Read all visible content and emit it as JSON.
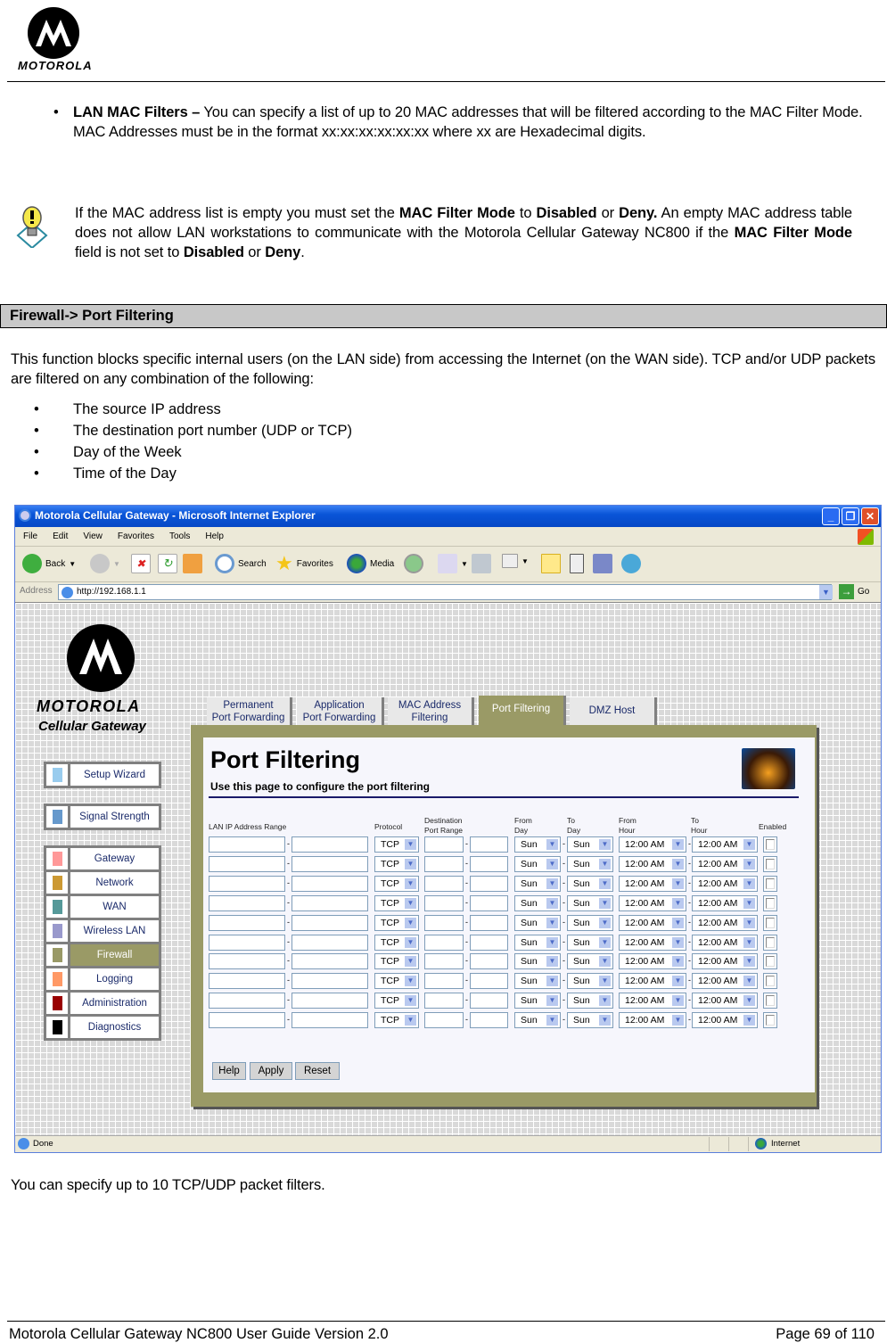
{
  "header": {
    "brand": "MOTOROLA"
  },
  "bullet_mac": {
    "bold": "LAN MAC Filters –",
    "text": " You can specify a list of up to 20 MAC addresses that will be filtered according to the MAC Filter Mode. MAC Addresses must be in the format xx:xx:xx:xx:xx:xx where xx are Hexadecimal digits."
  },
  "note": {
    "p1": "If the MAC address list is empty you must set the ",
    "b1": "MAC Filter Mode",
    "p2": " to ",
    "b2": "Disabled",
    "p3": " or ",
    "b3": "Deny.",
    "p4": " An empty MAC address table does not allow LAN workstations to communicate with the Motorola Cellular Gateway NC800 if the ",
    "b4": "MAC Filter Mode",
    "p5": " field is not set to ",
    "b5": "Disabled",
    "p6": " or ",
    "b6": "Deny",
    "p7": "."
  },
  "section_title": "Firewall-> Port Filtering",
  "intro": "This function blocks specific internal users (on the LAN side) from accessing the Internet (on the WAN side). TCP and/or UDP packets are filtered on any combination of the following:",
  "criteria": [
    "The source IP address",
    "The destination port number (UDP or TCP)",
    "Day of the Week",
    "Time of the Day"
  ],
  "browser": {
    "title": "Motorola Cellular Gateway - Microsoft Internet Explorer",
    "menu": [
      "File",
      "Edit",
      "View",
      "Favorites",
      "Tools",
      "Help"
    ],
    "toolbar": {
      "back": "Back",
      "search": "Search",
      "favorites": "Favorites",
      "media": "Media"
    },
    "address_label": "Address",
    "address_value": "http://192.168.1.1",
    "go_label": "Go",
    "status": "Done",
    "zone": "Internet"
  },
  "site": {
    "brand": "MOTOROLA",
    "product": "Cellular Gateway",
    "nav_top": [
      {
        "label": "Setup Wizard",
        "color": "#99ccee"
      },
      {
        "label": "Signal Strength",
        "color": "#6699cc"
      }
    ],
    "nav_main": [
      {
        "label": "Gateway",
        "color": "#ff9999"
      },
      {
        "label": "Network",
        "color": "#cc9933"
      },
      {
        "label": "WAN",
        "color": "#559999"
      },
      {
        "label": "Wireless LAN",
        "color": "#9999cc"
      },
      {
        "label": "Firewall",
        "color": "#999966",
        "active": true
      },
      {
        "label": "Logging",
        "color": "#ff9966"
      },
      {
        "label": "Administration",
        "color": "#990000"
      },
      {
        "label": "Diagnostics",
        "color": "#000000"
      }
    ],
    "tabs": [
      {
        "l1": "Permanent",
        "l2": "Port Forwarding"
      },
      {
        "l1": "Application",
        "l2": "Port Forwarding"
      },
      {
        "l1": "MAC Address",
        "l2": "Filtering"
      },
      {
        "l1": "Port Filtering",
        "l2": "",
        "active": true
      },
      {
        "l1": "DMZ Host",
        "l2": ""
      }
    ],
    "page_title": "Port Filtering",
    "page_subtitle": "Use this page to configure the port filtering",
    "columns": {
      "lan_ip": "LAN IP Address Range",
      "protocol": "Protocol",
      "dest1": "Destination",
      "dest2": "Port Range",
      "fromday1": "From",
      "fromday2": "Day",
      "today1": "To",
      "today2": "Day",
      "fromhour1": "From",
      "fromhour2": "Hour",
      "tohour1": "To",
      "tohour2": "Hour",
      "enabled": "Enabled"
    },
    "rows": [
      {
        "ip_start": "",
        "ip_end": "",
        "protocol": "TCP",
        "port_start": "",
        "port_end": "",
        "from_day": "Sun",
        "to_day": "Sun",
        "from_hour": "12:00 AM",
        "to_hour": "12:00 AM",
        "enabled": false
      },
      {
        "ip_start": "",
        "ip_end": "",
        "protocol": "TCP",
        "port_start": "",
        "port_end": "",
        "from_day": "Sun",
        "to_day": "Sun",
        "from_hour": "12:00 AM",
        "to_hour": "12:00 AM",
        "enabled": false
      },
      {
        "ip_start": "",
        "ip_end": "",
        "protocol": "TCP",
        "port_start": "",
        "port_end": "",
        "from_day": "Sun",
        "to_day": "Sun",
        "from_hour": "12:00 AM",
        "to_hour": "12:00 AM",
        "enabled": false
      },
      {
        "ip_start": "",
        "ip_end": "",
        "protocol": "TCP",
        "port_start": "",
        "port_end": "",
        "from_day": "Sun",
        "to_day": "Sun",
        "from_hour": "12:00 AM",
        "to_hour": "12:00 AM",
        "enabled": false
      },
      {
        "ip_start": "",
        "ip_end": "",
        "protocol": "TCP",
        "port_start": "",
        "port_end": "",
        "from_day": "Sun",
        "to_day": "Sun",
        "from_hour": "12:00 AM",
        "to_hour": "12:00 AM",
        "enabled": false
      },
      {
        "ip_start": "",
        "ip_end": "",
        "protocol": "TCP",
        "port_start": "",
        "port_end": "",
        "from_day": "Sun",
        "to_day": "Sun",
        "from_hour": "12:00 AM",
        "to_hour": "12:00 AM",
        "enabled": false
      },
      {
        "ip_start": "",
        "ip_end": "",
        "protocol": "TCP",
        "port_start": "",
        "port_end": "",
        "from_day": "Sun",
        "to_day": "Sun",
        "from_hour": "12:00 AM",
        "to_hour": "12:00 AM",
        "enabled": false
      },
      {
        "ip_start": "",
        "ip_end": "",
        "protocol": "TCP",
        "port_start": "",
        "port_end": "",
        "from_day": "Sun",
        "to_day": "Sun",
        "from_hour": "12:00 AM",
        "to_hour": "12:00 AM",
        "enabled": false
      },
      {
        "ip_start": "",
        "ip_end": "",
        "protocol": "TCP",
        "port_start": "",
        "port_end": "",
        "from_day": "Sun",
        "to_day": "Sun",
        "from_hour": "12:00 AM",
        "to_hour": "12:00 AM",
        "enabled": false
      },
      {
        "ip_start": "",
        "ip_end": "",
        "protocol": "TCP",
        "port_start": "",
        "port_end": "",
        "from_day": "Sun",
        "to_day": "Sun",
        "from_hour": "12:00 AM",
        "to_hour": "12:00 AM",
        "enabled": false
      }
    ],
    "buttons": {
      "help": "Help",
      "apply": "Apply",
      "reset": "Reset"
    },
    "range_separator": "-"
  },
  "after_text": "You can specify up to 10 TCP/UDP packet filters.",
  "footer": {
    "left": "Motorola Cellular Gateway NC800 User Guide Version 2.0",
    "right": "Page 69 of 110"
  }
}
